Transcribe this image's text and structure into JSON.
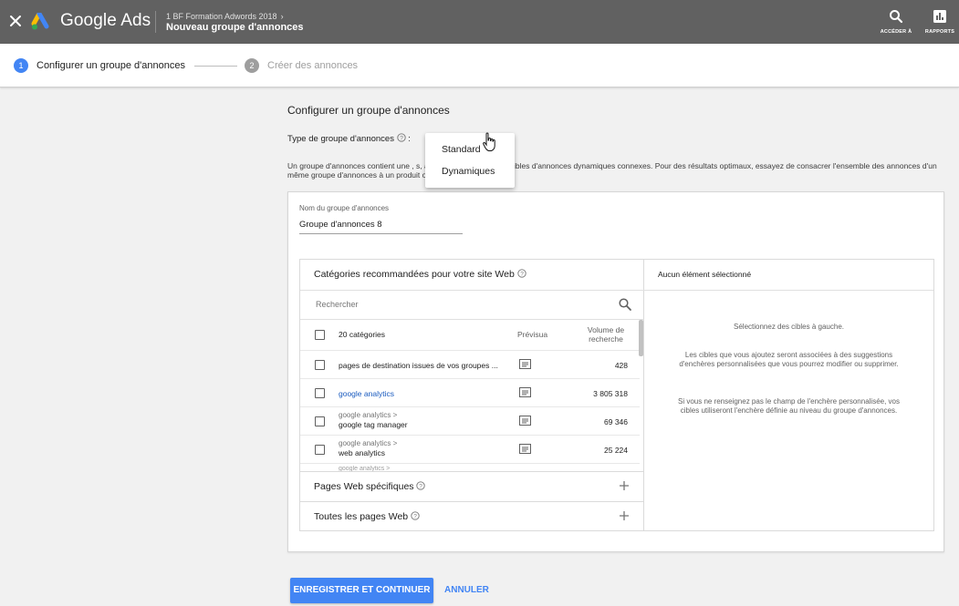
{
  "header": {
    "brand": "Google Ads",
    "account": "1 BF Formation Adwords 2018",
    "page": "Nouveau groupe d'annonces",
    "tools": [
      {
        "label": "ACCÉDER À",
        "icon": "search-icon"
      },
      {
        "label": "RAPPORTS",
        "icon": "reports-icon"
      }
    ]
  },
  "stepper": {
    "steps": [
      {
        "num": "1",
        "label": "Configurer un groupe d'annonces",
        "active": true
      },
      {
        "num": "2",
        "label": "Créer des annonces",
        "active": false
      }
    ]
  },
  "main": {
    "title": "Configurer un groupe d'annonces",
    "type_label": "Type de groupe d'annonces",
    "intro": "Un groupe d'annonces contient une  ,                          s, ainsi qu'un ensemble de cibles d'annonces dynamiques connexes. Pour des résultats optimaux, essayez de consacrer l'ensemble des annonces            d'un même groupe d'annonces à un produit ou service particulier.",
    "dropdown": {
      "options": [
        "Standard",
        "Dynamiques"
      ]
    }
  },
  "form": {
    "name_label": "Nom du groupe d'annonces",
    "name_value": "Groupe d'annonces 8"
  },
  "categories": {
    "title": "Catégories recommandées pour votre site Web",
    "search_placeholder": "Rechercher",
    "header": {
      "count": "20 catégories",
      "preview": "Prévisua",
      "volume": "Volume de recherche"
    },
    "rows": [
      {
        "parent": "",
        "name": "pages de destination issues de vos groupes ...",
        "volume": "428",
        "link": false
      },
      {
        "parent": "",
        "name": "google analytics",
        "volume": "3 805 318",
        "link": true
      },
      {
        "parent": "google analytics >",
        "name": "google tag manager",
        "volume": "69 346",
        "link": false
      },
      {
        "parent": "google analytics >",
        "name": "web analytics",
        "volume": "25 224",
        "link": false
      }
    ],
    "partial": "google analytics >"
  },
  "accordions": [
    {
      "label": "Pages Web spécifiques"
    },
    {
      "label": "Toutes les pages Web"
    }
  ],
  "selection": {
    "title": "Aucun élément sélectionné",
    "hint1": "Sélectionnez des cibles à gauche.",
    "hint2": "Les cibles que vous ajoutez seront associées à des suggestions d'enchères personnalisées que vous pourrez modifier ou supprimer.",
    "hint3": "Si vous ne renseignez pas le champ de l'enchère personnalisée, vos cibles utiliseront l'enchère définie au niveau du groupe d'annonces."
  },
  "actions": {
    "save": "ENREGISTRER ET CONTINUER",
    "cancel": "ANNULER"
  },
  "colors": {
    "accent": "#4285f4",
    "topbar": "#616161",
    "link": "#1a5bbf"
  }
}
